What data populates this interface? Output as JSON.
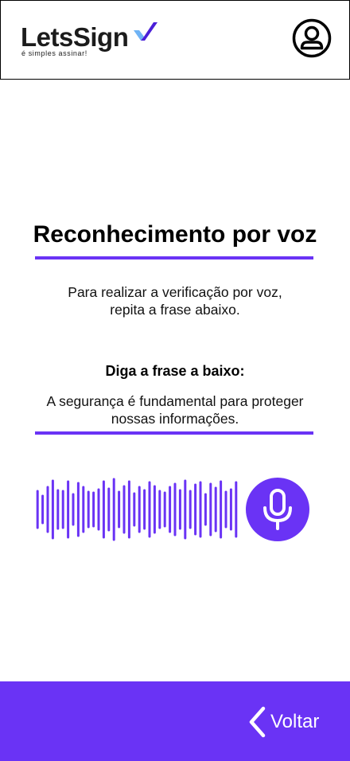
{
  "header": {
    "logo": {
      "name": "LetsSign",
      "tagline": "é simples assinar!"
    },
    "profile_icon": "user-circle-icon"
  },
  "main": {
    "title": "Reconhecimento por voz",
    "instruction": {
      "line1": "Para realizar a verificação por voz,",
      "line2": "repita a frase abaixo."
    },
    "phrase_label": "Diga a frase a baixo:",
    "phrase": {
      "line1": "A segurança é fundamental para proteger",
      "line2": "nossas informações."
    },
    "waveform_icon": "audio-waveform-icon",
    "mic_icon": "microphone-icon"
  },
  "footer": {
    "back_label": "Voltar",
    "back_icon": "chevron-left-icon"
  },
  "colors": {
    "accent": "#6a33f5",
    "logo_check_dark": "#4a1fd8",
    "logo_check_light": "#6fb3f5",
    "text": "#111111",
    "background": "#ffffff"
  }
}
